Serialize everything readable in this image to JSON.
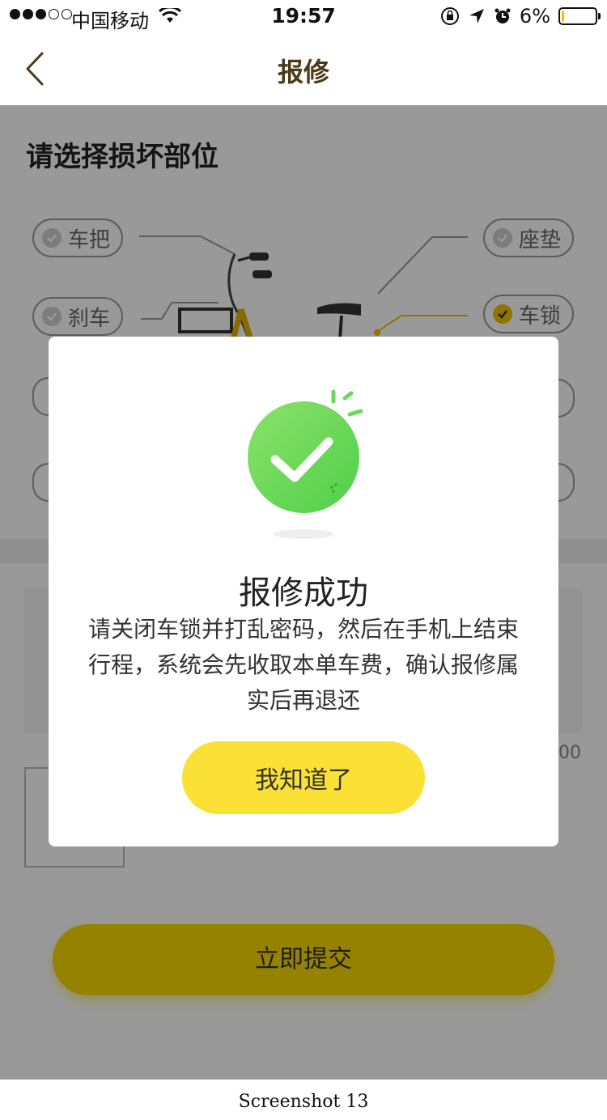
{
  "status_bar": {
    "carrier": "中国移动",
    "time": "19:57",
    "battery_percent": "6%",
    "battery_level": 0.06,
    "signal_bars_filled": 3,
    "signal_bars_total": 5,
    "icons": [
      "wifi-icon",
      "rotation-lock-icon",
      "location-arrow-icon",
      "alarm-icon",
      "battery-icon"
    ]
  },
  "nav": {
    "title": "报修",
    "back_icon": "chevron-left-icon"
  },
  "page": {
    "section_title": "请选择损坏部位",
    "parts": [
      {
        "label": "车把",
        "selected": false
      },
      {
        "label": "刹车",
        "selected": false
      },
      {
        "label": "座垫",
        "selected": false
      },
      {
        "label": "车锁",
        "selected": true
      }
    ],
    "desc_counter": "00",
    "submit_label": "立即提交"
  },
  "modal": {
    "title": "报修成功",
    "message": "请关闭车锁并打乱密码，然后在手机上结束行程，系统会先收取本单车费，确认报修属实后再退还",
    "button_label": "我知道了",
    "icon": "success-check-icon"
  },
  "colors": {
    "accent_yellow": "#f7d900",
    "success_green": "#5fd64f",
    "nav_title": "#4a3a1a"
  },
  "caption": "Screenshot 13"
}
